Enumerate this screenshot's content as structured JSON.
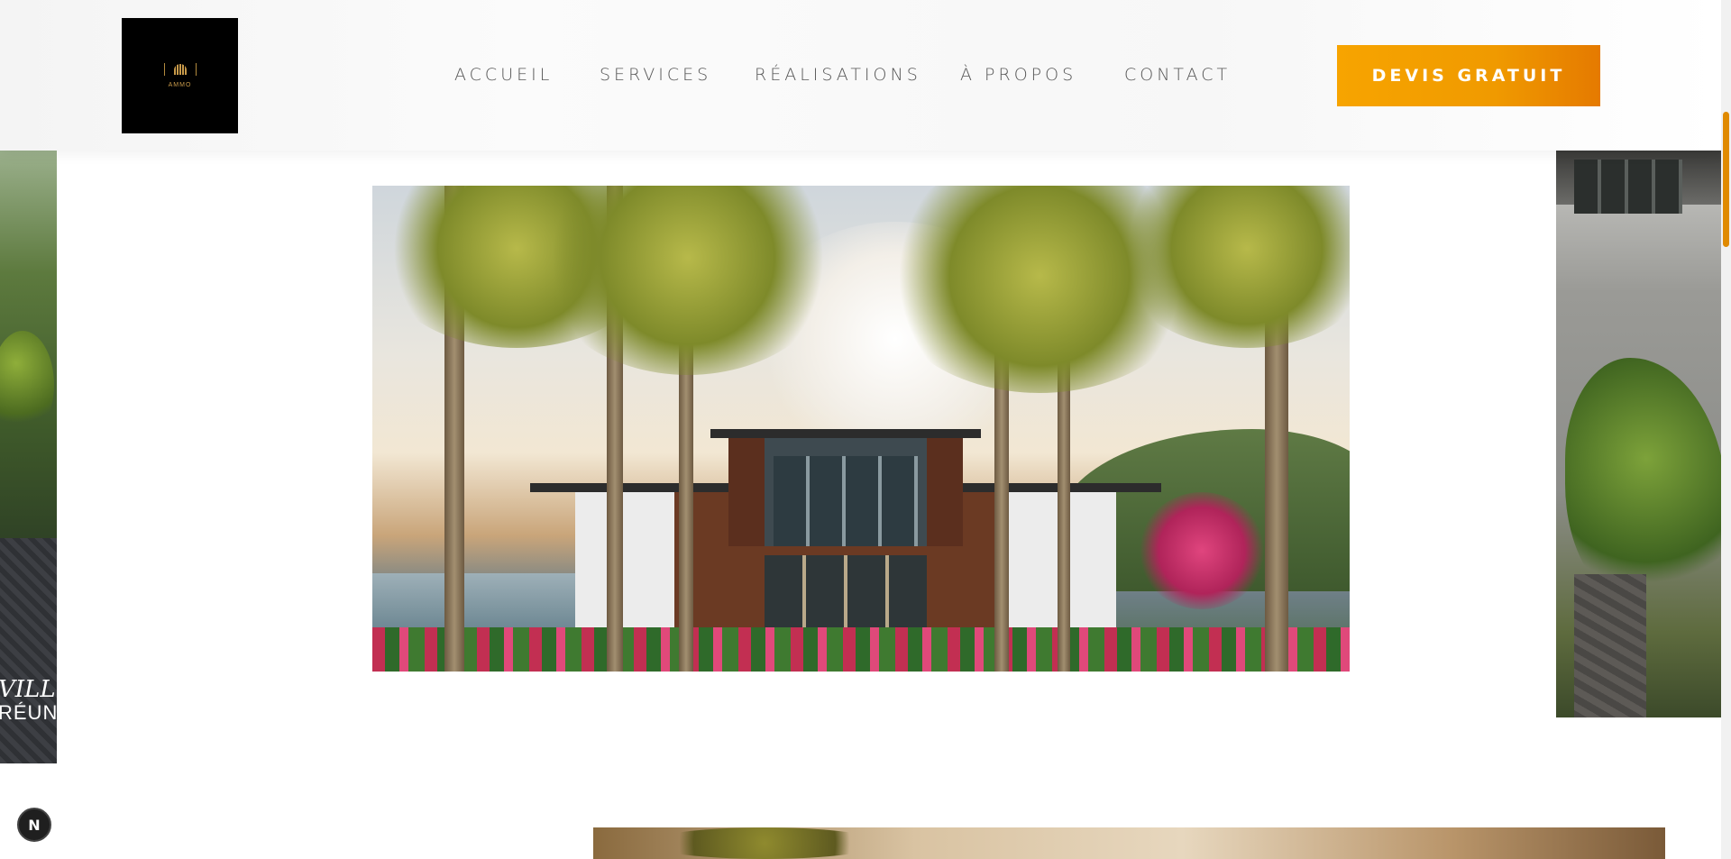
{
  "brand": {
    "logo_icon": "arch-logo-icon",
    "logo_text": "AMMO",
    "logo_color": "#c89a4a",
    "overlay_brand_line1": "VILL",
    "overlay_brand_line2": "RÉUN"
  },
  "nav": {
    "items": [
      {
        "label": "ACCUEIL"
      },
      {
        "label": "SERVICES"
      },
      {
        "label": "RÉALISATIONS"
      },
      {
        "label": "À PROPOS"
      },
      {
        "label": "CONTACT"
      }
    ]
  },
  "cta": {
    "label": "DEVIS GRATUIT",
    "color": "#f7a400"
  },
  "badge": {
    "label": "N"
  },
  "colors": {
    "accent": "#f09a00",
    "nav_text": "#555555",
    "scroll_thumb": "#e08a00"
  }
}
